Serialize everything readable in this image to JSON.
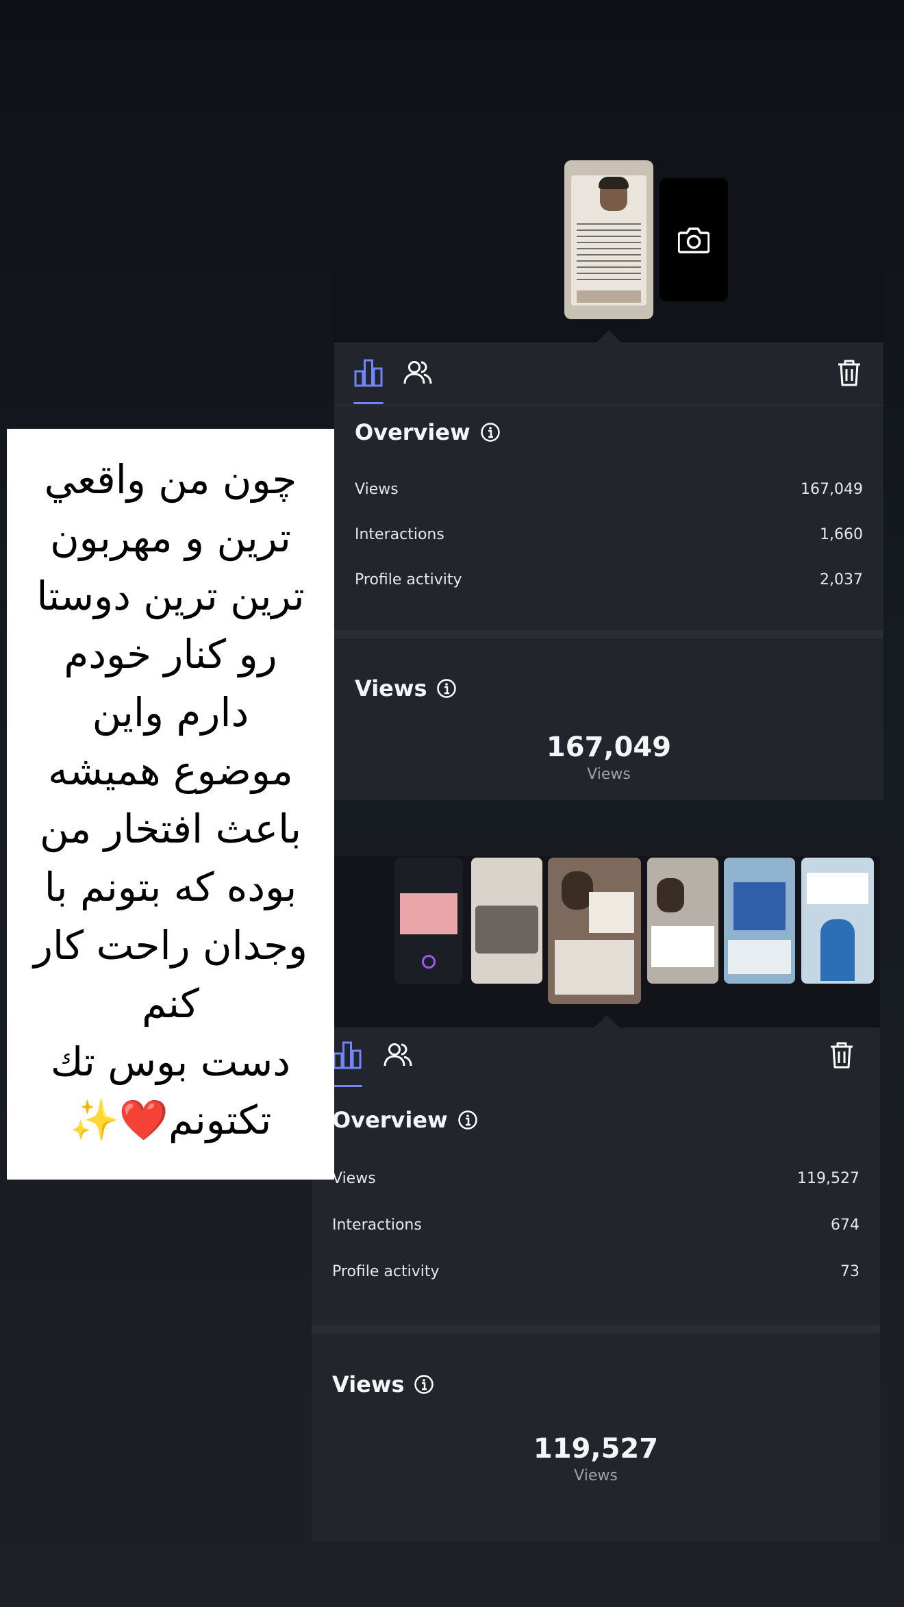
{
  "top_insights": {
    "tabs": [
      {
        "icon": "bar-chart-icon"
      },
      {
        "icon": "people-icon"
      }
    ],
    "delete_icon": "trash-icon",
    "camera_icon": "camera-icon",
    "overview": {
      "title": "Overview",
      "rows": [
        {
          "label": "Views",
          "value": "167,049"
        },
        {
          "label": "Interactions",
          "value": "1,660"
        },
        {
          "label": "Profile activity",
          "value": "2,037"
        }
      ]
    },
    "views": {
      "title": "Views",
      "total": "167,049",
      "unit": "Views"
    }
  },
  "bottom_insights": {
    "overview": {
      "title": "Overview",
      "rows": [
        {
          "label": "Views",
          "value": "119,527"
        },
        {
          "label": "Interactions",
          "value": "674"
        },
        {
          "label": "Profile activity",
          "value": "73"
        }
      ]
    },
    "views": {
      "title": "Views",
      "total": "119,527",
      "unit": "Views"
    }
  },
  "caption": {
    "lines": [
      "چون من واقعي",
      "ترين و مهربون",
      "ترين ترين دوستا",
      "رو كنار خودم",
      "دارم واين",
      "موضوع هميشه",
      "باعث افتخار من",
      "بوده كه بتونم با",
      "وجدان راحت كار",
      "كنم",
      "دست بوس تك",
      "تكتونم"
    ],
    "emoji_sparkles": "✨",
    "emoji_heart": "❤️"
  },
  "colors": {
    "background": "#0e1117",
    "card": "#22252b",
    "accent": "#6f86ff",
    "text": "#f4f5f7",
    "muted": "#9ea2aa"
  }
}
